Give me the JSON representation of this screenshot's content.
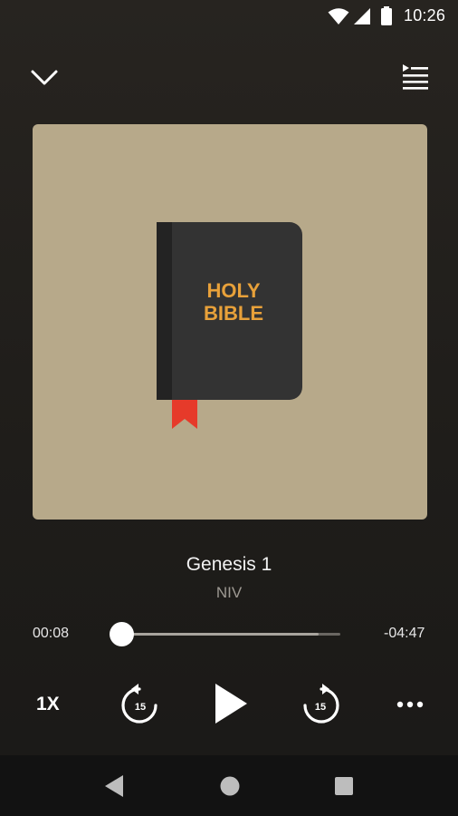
{
  "status_bar": {
    "time": "10:26",
    "icons": [
      "wifi-icon",
      "signal-icon",
      "battery-icon"
    ]
  },
  "header": {
    "icons": [
      "chevron-down-icon",
      "playlist-icon"
    ]
  },
  "artwork": {
    "book_title_line1": "HOLY",
    "book_title_line2": "BIBLE",
    "background_color": "#b7a98a",
    "book_color": "#333333",
    "text_color": "#e8a13a",
    "bookmark_color": "#e63a2a"
  },
  "track": {
    "title": "Genesis 1",
    "subtitle": "NIV"
  },
  "progress": {
    "elapsed": "00:08",
    "remaining": "-04:47",
    "played_fraction": 0.03,
    "buffered_fraction": 0.9
  },
  "controls": {
    "speed_label": "1X",
    "rewind_seconds": "15",
    "forward_seconds": "15",
    "icons": [
      "rewind-15-icon",
      "play-icon",
      "forward-15-icon",
      "more-icon"
    ]
  },
  "nav_bar": {
    "icons": [
      "back-icon",
      "home-icon",
      "recents-icon"
    ]
  }
}
